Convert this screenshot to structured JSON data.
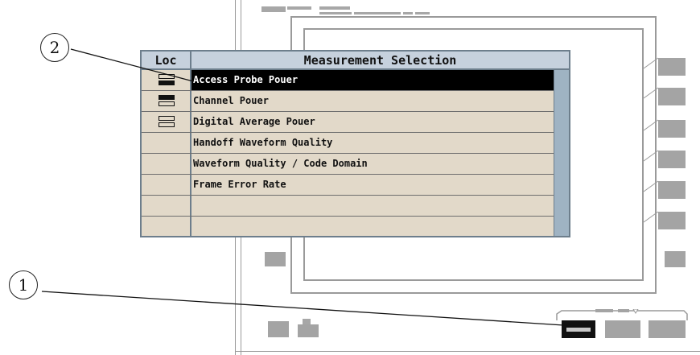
{
  "menu": {
    "loc_header": "Loc",
    "title": "Measurement Selection",
    "items": [
      {
        "label": "Access Probe Pouer",
        "selected": true,
        "loc_icon": "top-open-bottom-filled"
      },
      {
        "label": "Channel Pouer",
        "selected": false,
        "loc_icon": "top-filled-bottom-open"
      },
      {
        "label": "Digital Average Pouer",
        "selected": false,
        "loc_icon": "both-open"
      },
      {
        "label": "Handoff Waveform Quality",
        "selected": false,
        "loc_icon": ""
      },
      {
        "label": "Waveform Quality / Code Domain",
        "selected": false,
        "loc_icon": ""
      },
      {
        "label": "Frame Error Rate",
        "selected": false,
        "loc_icon": ""
      },
      {
        "label": "",
        "selected": false,
        "loc_icon": ""
      },
      {
        "label": "",
        "selected": false,
        "loc_icon": ""
      }
    ]
  },
  "callouts": {
    "one": "1",
    "two": "2"
  },
  "colors": {
    "menu_bg": "#e2d9c9",
    "header_bg": "#c6d1dd",
    "border": "#6d7e8c",
    "selected_bg": "#000000",
    "key_gray": "#a4a4a4"
  }
}
